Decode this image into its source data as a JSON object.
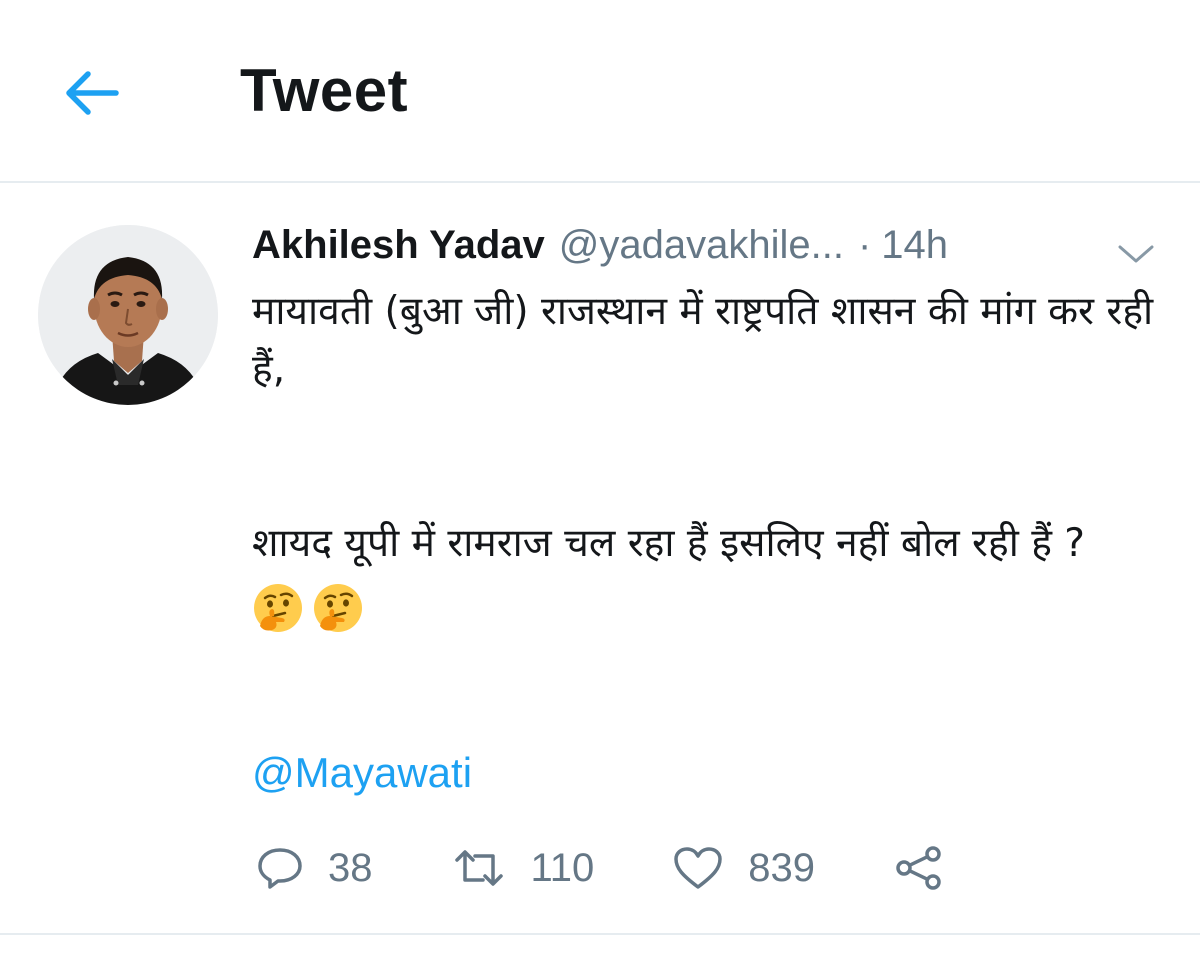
{
  "header": {
    "title": "Tweet",
    "back_icon": "arrow-left-icon"
  },
  "colors": {
    "accent": "#1da1f2",
    "text_primary": "#14171a",
    "text_secondary": "#657786",
    "divider": "#e6ecf0"
  },
  "tweet": {
    "author": {
      "name": "Akhilesh Yadav",
      "handle": "@yadavakhile...",
      "separator": "·",
      "time": "14h"
    },
    "body": {
      "line1": "मायावती (बुआ जी) राजस्थान में राष्ट्रपति शासन की मांग कर रही हैं,",
      "line2": "शायद यूपी में रामराज चल रहा हैं इसलिए नहीं बोल रही हैं ?",
      "emojis": [
        "thinking-face-emoji",
        "thinking-face-emoji"
      ]
    },
    "mention": "@Mayawati",
    "actions": {
      "replies": "38",
      "retweets": "110",
      "likes": "839"
    }
  }
}
